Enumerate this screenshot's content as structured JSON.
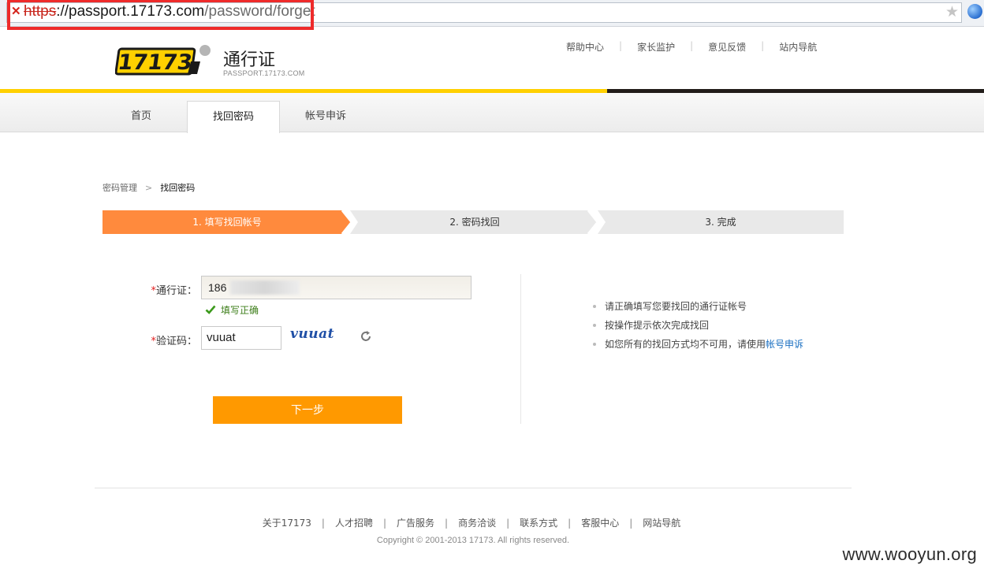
{
  "browser": {
    "url_protocol": "https",
    "url_host": "passport.17173.com",
    "url_path": "/password/forget",
    "url_sep": "://"
  },
  "header": {
    "logo_text": "17173",
    "title": "通行证",
    "subtitle": "PASSPORT.17173.COM",
    "links": [
      "帮助中心",
      "家长监护",
      "意见反馈",
      "站内导航"
    ]
  },
  "nav": {
    "tabs": [
      {
        "label": "首页",
        "active": false
      },
      {
        "label": "找回密码",
        "active": true
      },
      {
        "label": "帐号申诉",
        "active": false
      }
    ]
  },
  "breadcrumb": {
    "parent": "密码管理",
    "arrow": ">",
    "current": "找回密码"
  },
  "steps": [
    {
      "label": "1. 填写找回帐号",
      "active": true
    },
    {
      "label": "2. 密码找回",
      "active": false
    },
    {
      "label": "3. 完成",
      "active": false
    }
  ],
  "form": {
    "required_mark": "*",
    "account_label": "通行证：",
    "account_value": "186",
    "account_ok": "填写正确",
    "captcha_label": "验证码：",
    "captcha_value": "vuuat",
    "captcha_image_text": "vuuat",
    "next_button": "下一步"
  },
  "tips": {
    "items": [
      "请正确填写您要找回的通行证帐号",
      "按操作提示依次完成找回"
    ],
    "last_prefix": "如您所有的找回方式均不可用，请使用",
    "last_link": "帐号申诉"
  },
  "footer": {
    "links": [
      "关于17173",
      "人才招聘",
      "广告服务",
      "商务洽谈",
      "联系方式",
      "客服中心",
      "网站导航"
    ],
    "separator": "|",
    "copyright": "Copyright © 2001-2013 17173. All rights reserved."
  },
  "watermark": "www.wooyun.org",
  "colors": {
    "accent_orange": "#ff9900",
    "step_active": "#ff8a3d",
    "step_inactive": "#e9e9e9",
    "brand_yellow": "#ffd000",
    "highlight_red": "#ee2b2b",
    "link_blue": "#1a6fc1"
  }
}
